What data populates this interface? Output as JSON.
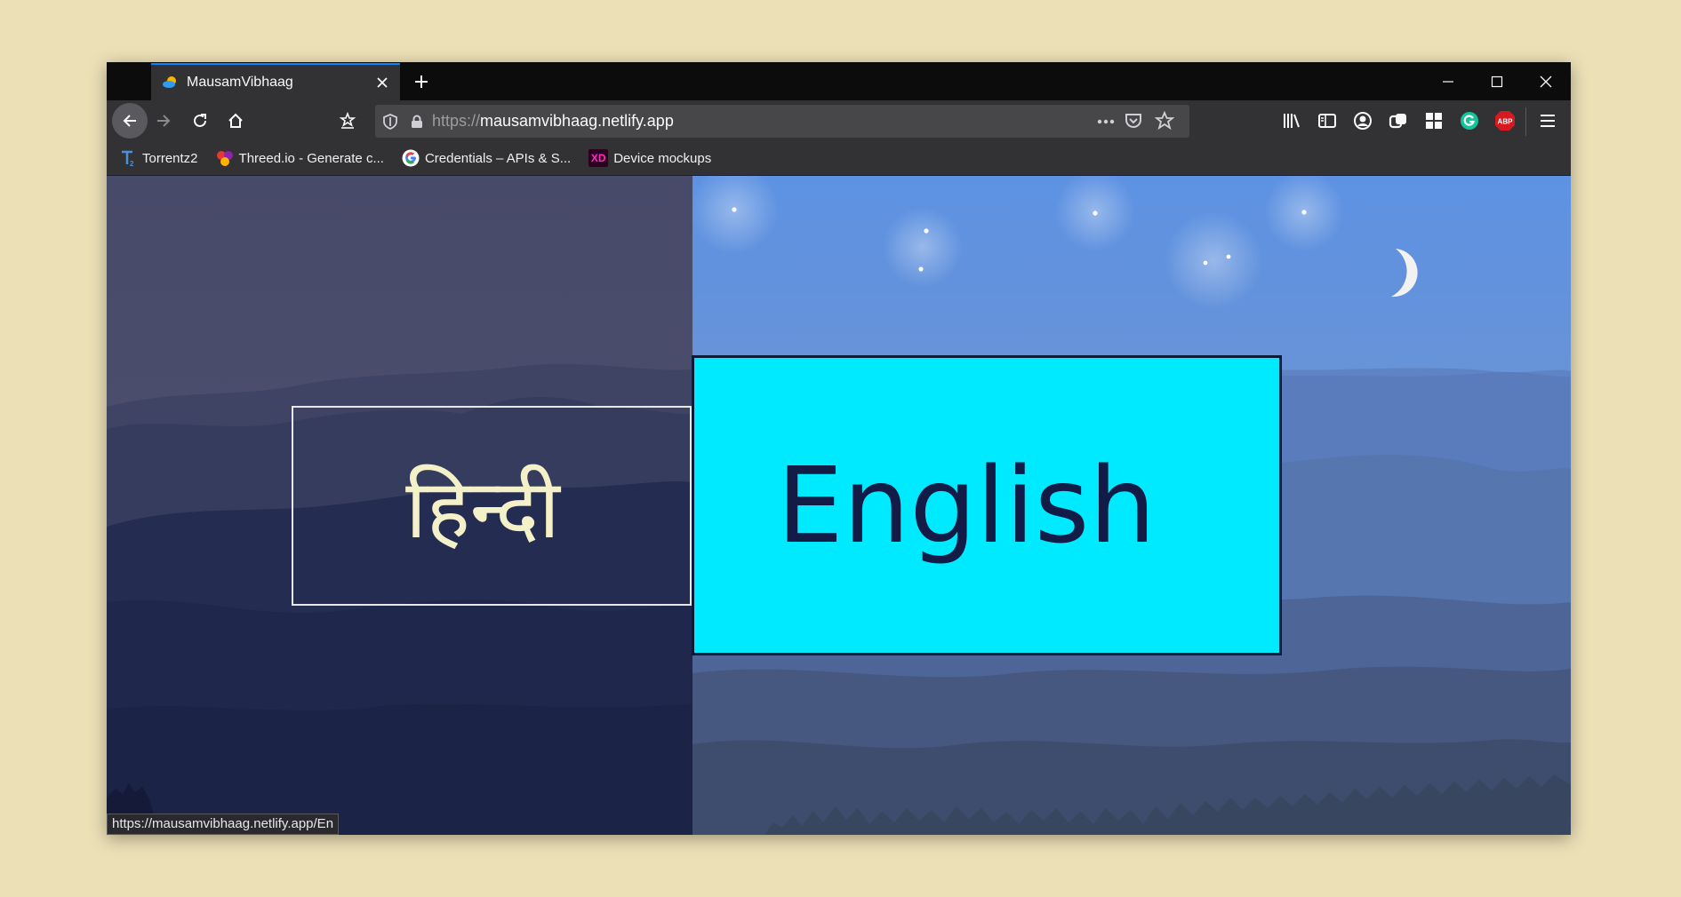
{
  "browser": {
    "tab": {
      "title": "MausamVibhaag"
    },
    "url": {
      "scheme": "https://",
      "host": "mausamvibhaag.netlify.app"
    },
    "bookmarks": [
      {
        "label": "Torrentz2",
        "icon": "torrentz-icon"
      },
      {
        "label": "Threed.io - Generate c...",
        "icon": "threed-icon"
      },
      {
        "label": "Credentials – APIs & S...",
        "icon": "google-icon"
      },
      {
        "label": "Device mockups",
        "icon": "xd-icon",
        "icon_text": "XD"
      }
    ],
    "extensions": {
      "abp_text": "ABP"
    },
    "status_url": "https://mausamvibhaag.netlify.app/En"
  },
  "page": {
    "hindi_label": "हिन्दी",
    "english_label": "English"
  },
  "colors": {
    "english_box": "#00eaff",
    "accent": "#0a84ff"
  }
}
